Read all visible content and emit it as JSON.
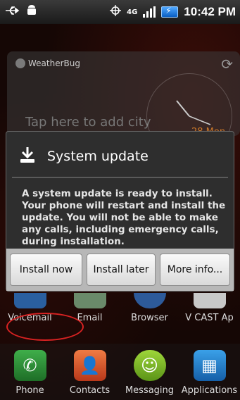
{
  "status_bar": {
    "network_type": "4G",
    "time": "10:42 PM",
    "icons": [
      "usb-icon",
      "android-debug-icon",
      "gps-icon",
      "signal-icon",
      "battery-charging-icon"
    ]
  },
  "widget": {
    "brand": "WeatherBug",
    "prompt": "Tap here to add city",
    "date": "28 Mon"
  },
  "dialog": {
    "title": "System update",
    "message": "A system update is ready to install. Your phone will restart and install the update. You will not be able to make any calls, including emergency calls, during installation.",
    "buttons": {
      "install_now": "Install now",
      "install_later": "Install later",
      "more_info": "More info..."
    }
  },
  "home": {
    "row1": [
      "Voicemail",
      "Email",
      "Browser",
      "V CAST Ap"
    ],
    "dock": [
      "Phone",
      "Contacts",
      "Messaging",
      "Applications"
    ]
  }
}
